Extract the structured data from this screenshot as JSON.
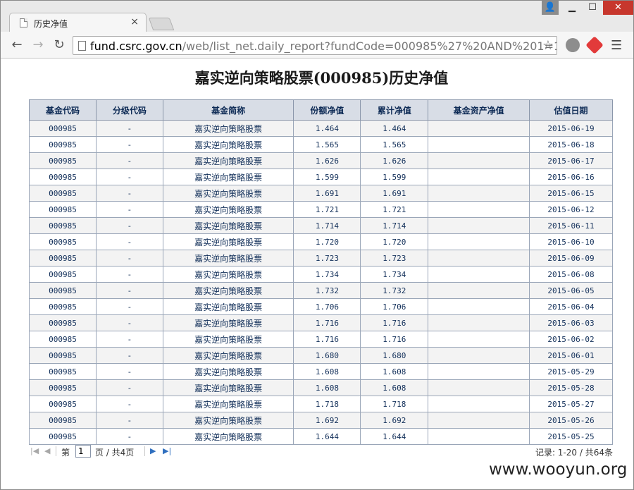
{
  "browser": {
    "tab_title": "历史净值",
    "url_host": "fund.csrc.gov.cn",
    "url_path": "/web/list_net.daily_report?fundCode=000985%27%20AND%201=1%",
    "window_buttons": {
      "minimize": "▁",
      "maximize": "☐",
      "close": "✕"
    }
  },
  "page": {
    "title": "嘉实逆向策略股票(000985)历史净值"
  },
  "table": {
    "headers": [
      "基金代码",
      "分级代码",
      "基金简称",
      "份额净值",
      "累计净值",
      "基金资产净值",
      "估值日期"
    ],
    "rows": [
      [
        "000985",
        "-",
        "嘉实逆向策略股票",
        "1.464",
        "1.464",
        "",
        "2015-06-19"
      ],
      [
        "000985",
        "-",
        "嘉实逆向策略股票",
        "1.565",
        "1.565",
        "",
        "2015-06-18"
      ],
      [
        "000985",
        "-",
        "嘉实逆向策略股票",
        "1.626",
        "1.626",
        "",
        "2015-06-17"
      ],
      [
        "000985",
        "-",
        "嘉实逆向策略股票",
        "1.599",
        "1.599",
        "",
        "2015-06-16"
      ],
      [
        "000985",
        "-",
        "嘉实逆向策略股票",
        "1.691",
        "1.691",
        "",
        "2015-06-15"
      ],
      [
        "000985",
        "-",
        "嘉实逆向策略股票",
        "1.721",
        "1.721",
        "",
        "2015-06-12"
      ],
      [
        "000985",
        "-",
        "嘉实逆向策略股票",
        "1.714",
        "1.714",
        "",
        "2015-06-11"
      ],
      [
        "000985",
        "-",
        "嘉实逆向策略股票",
        "1.720",
        "1.720",
        "",
        "2015-06-10"
      ],
      [
        "000985",
        "-",
        "嘉实逆向策略股票",
        "1.723",
        "1.723",
        "",
        "2015-06-09"
      ],
      [
        "000985",
        "-",
        "嘉实逆向策略股票",
        "1.734",
        "1.734",
        "",
        "2015-06-08"
      ],
      [
        "000985",
        "-",
        "嘉实逆向策略股票",
        "1.732",
        "1.732",
        "",
        "2015-06-05"
      ],
      [
        "000985",
        "-",
        "嘉实逆向策略股票",
        "1.706",
        "1.706",
        "",
        "2015-06-04"
      ],
      [
        "000985",
        "-",
        "嘉实逆向策略股票",
        "1.716",
        "1.716",
        "",
        "2015-06-03"
      ],
      [
        "000985",
        "-",
        "嘉实逆向策略股票",
        "1.716",
        "1.716",
        "",
        "2015-06-02"
      ],
      [
        "000985",
        "-",
        "嘉实逆向策略股票",
        "1.680",
        "1.680",
        "",
        "2015-06-01"
      ],
      [
        "000985",
        "-",
        "嘉实逆向策略股票",
        "1.608",
        "1.608",
        "",
        "2015-05-29"
      ],
      [
        "000985",
        "-",
        "嘉实逆向策略股票",
        "1.608",
        "1.608",
        "",
        "2015-05-28"
      ],
      [
        "000985",
        "-",
        "嘉实逆向策略股票",
        "1.718",
        "1.718",
        "",
        "2015-05-27"
      ],
      [
        "000985",
        "-",
        "嘉实逆向策略股票",
        "1.692",
        "1.692",
        "",
        "2015-05-26"
      ],
      [
        "000985",
        "-",
        "嘉实逆向策略股票",
        "1.644",
        "1.644",
        "",
        "2015-05-25"
      ]
    ]
  },
  "pager": {
    "page_prefix": "第",
    "current_page": "1",
    "page_suffix": "页 / 共4页",
    "records": "记录: 1-20 / 共64条"
  },
  "watermark": "www.wooyun.org"
}
